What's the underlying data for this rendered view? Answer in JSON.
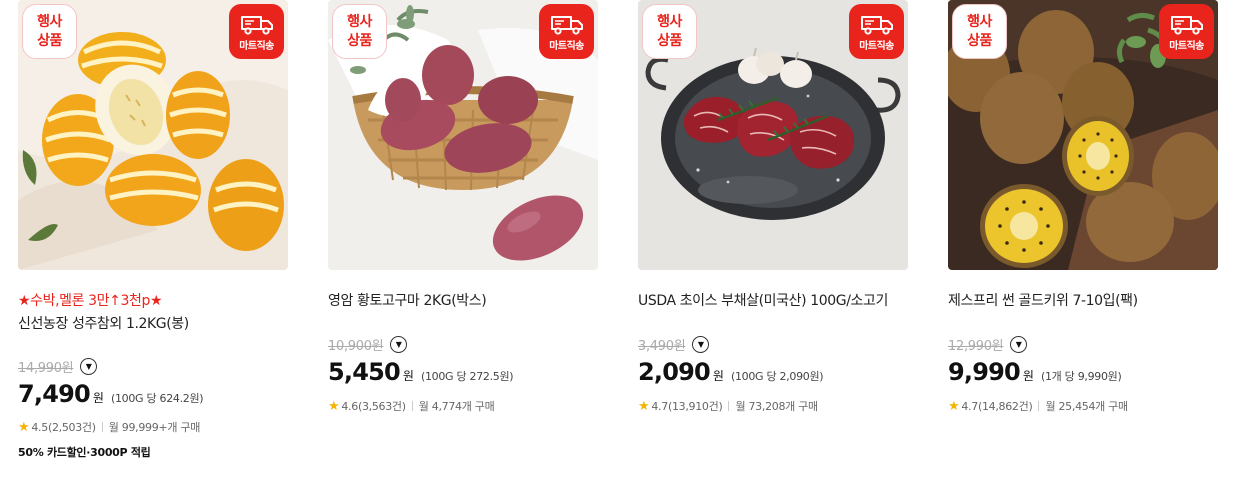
{
  "products": [
    {
      "event_badge": [
        "행사",
        "상품"
      ],
      "mart_badge": "마트직송",
      "promo": "★수박,멜론 3만↑3천p★",
      "title": "신선농장 성주참외 1.2KG(봉)",
      "original_price": "14,990원",
      "price": "7,490",
      "currency": "원",
      "unit_price": "(100G 당 624.2원)",
      "rating": "4.5(2,503건)",
      "monthly": "월 99,999+개 구매",
      "benefit": "50% 카드할인·3000P 적립",
      "image_icon": "oriental-melon-photo"
    },
    {
      "event_badge": [
        "행사",
        "상품"
      ],
      "mart_badge": "마트직송",
      "title": "영암 황토고구마 2KG(박스)",
      "original_price": "10,900원",
      "price": "5,450",
      "currency": "원",
      "unit_price": "(100G 당 272.5원)",
      "rating": "4.6(3,563건)",
      "monthly": "월 4,774개 구매",
      "image_icon": "sweet-potato-photo"
    },
    {
      "event_badge": [
        "행사",
        "상품"
      ],
      "mart_badge": "마트직송",
      "title": "USDA 초이스 부채살(미국산) 100G/소고기",
      "original_price": "3,490원",
      "price": "2,090",
      "currency": "원",
      "unit_price": "(100G 당 2,090원)",
      "rating": "4.7(13,910건)",
      "monthly": "월 73,208개 구매",
      "image_icon": "beef-steak-photo"
    },
    {
      "event_badge": [
        "행사",
        "상품"
      ],
      "mart_badge": "마트직송",
      "title": "제스프리 썬 골드키위 7-10입(팩)",
      "original_price": "12,990원",
      "price": "9,990",
      "currency": "원",
      "unit_price": "(1개 당 9,990원)",
      "rating": "4.7(14,862건)",
      "monthly": "월 25,454개 구매",
      "image_icon": "gold-kiwi-photo"
    }
  ],
  "colors": {
    "accent_red": "#e8241d",
    "star": "#f5b301",
    "strike_gray": "#aaaaaa"
  }
}
